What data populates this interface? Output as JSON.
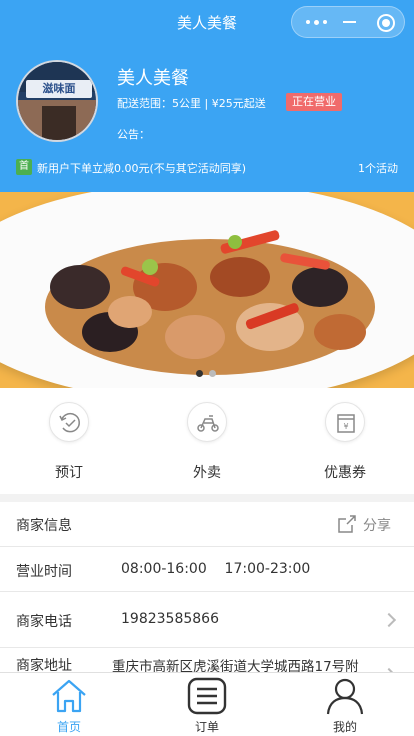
{
  "nav": {
    "title": "美人美餐"
  },
  "shop": {
    "name": "美人美餐",
    "logo_sign_text": "滋味面",
    "delivery_info": "配送范围：5公里 | ¥25元起送",
    "status": "正在营业",
    "notice": "公告：",
    "promo_tag": "首",
    "promo_text": "新用户下单立减0.00元(不与其它活动同享)",
    "promo_count": "1个活动"
  },
  "banner": {
    "page_count": 2,
    "active_page": 1
  },
  "actions": [
    {
      "label": "预订",
      "icon": "reserve-icon"
    },
    {
      "label": "外卖",
      "icon": "delivery-scooter-icon"
    },
    {
      "label": "优惠券",
      "icon": "coupon-icon"
    }
  ],
  "merchant": {
    "section_title": "商家信息",
    "share_label": "分享",
    "hours_label": "营业时间",
    "hours_value": "08:00-16:00    17:00-23:00",
    "phone_label": "商家电话",
    "phone_value": "19823585866",
    "address_label": "商家地址",
    "address_value": "重庆市高新区虎溪街道大学城西路17号附"
  },
  "tabs": [
    {
      "label": "首页",
      "icon": "home-icon",
      "active": true
    },
    {
      "label": "订单",
      "icon": "order-list-icon",
      "active": false
    },
    {
      "label": "我的",
      "icon": "user-icon",
      "active": false
    }
  ],
  "colors": {
    "brand": "#3ba4f3",
    "status_badge": "#f06b6b",
    "promo_tag": "#4caf50",
    "tab_active": "#3ba4f3"
  }
}
